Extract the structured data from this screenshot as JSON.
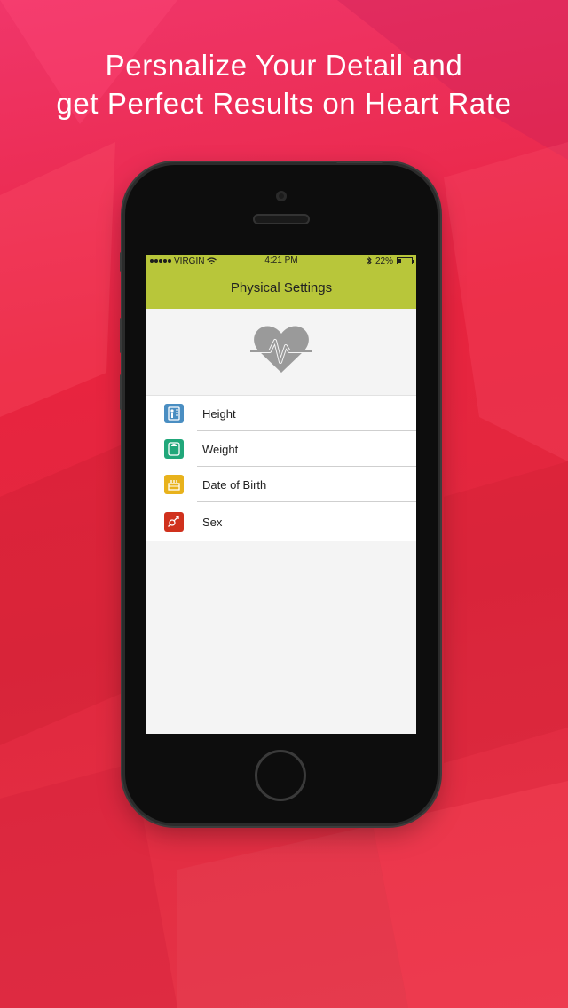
{
  "headline": {
    "line1": "Persnalize Your Detail and",
    "line2": "get Perfect Results on Heart Rate"
  },
  "status_bar": {
    "carrier": "VIRGIN",
    "time": "4:21 PM",
    "battery": "22%",
    "battery_level": 0.22
  },
  "nav": {
    "title": "Physical Settings"
  },
  "hero": {
    "icon": "heart-pulse-icon"
  },
  "settings": [
    {
      "label": "Height",
      "icon": "height-icon",
      "color": "#4a8ec2"
    },
    {
      "label": "Weight",
      "icon": "weight-scale-icon",
      "color": "#21a77a"
    },
    {
      "label": "Date of Birth",
      "icon": "birthday-cake-icon",
      "color": "#e8b21c"
    },
    {
      "label": "Sex",
      "icon": "gender-icon",
      "color": "#d0311d"
    }
  ],
  "colors": {
    "accent": "#b8c63a",
    "background": "#e8243f"
  }
}
